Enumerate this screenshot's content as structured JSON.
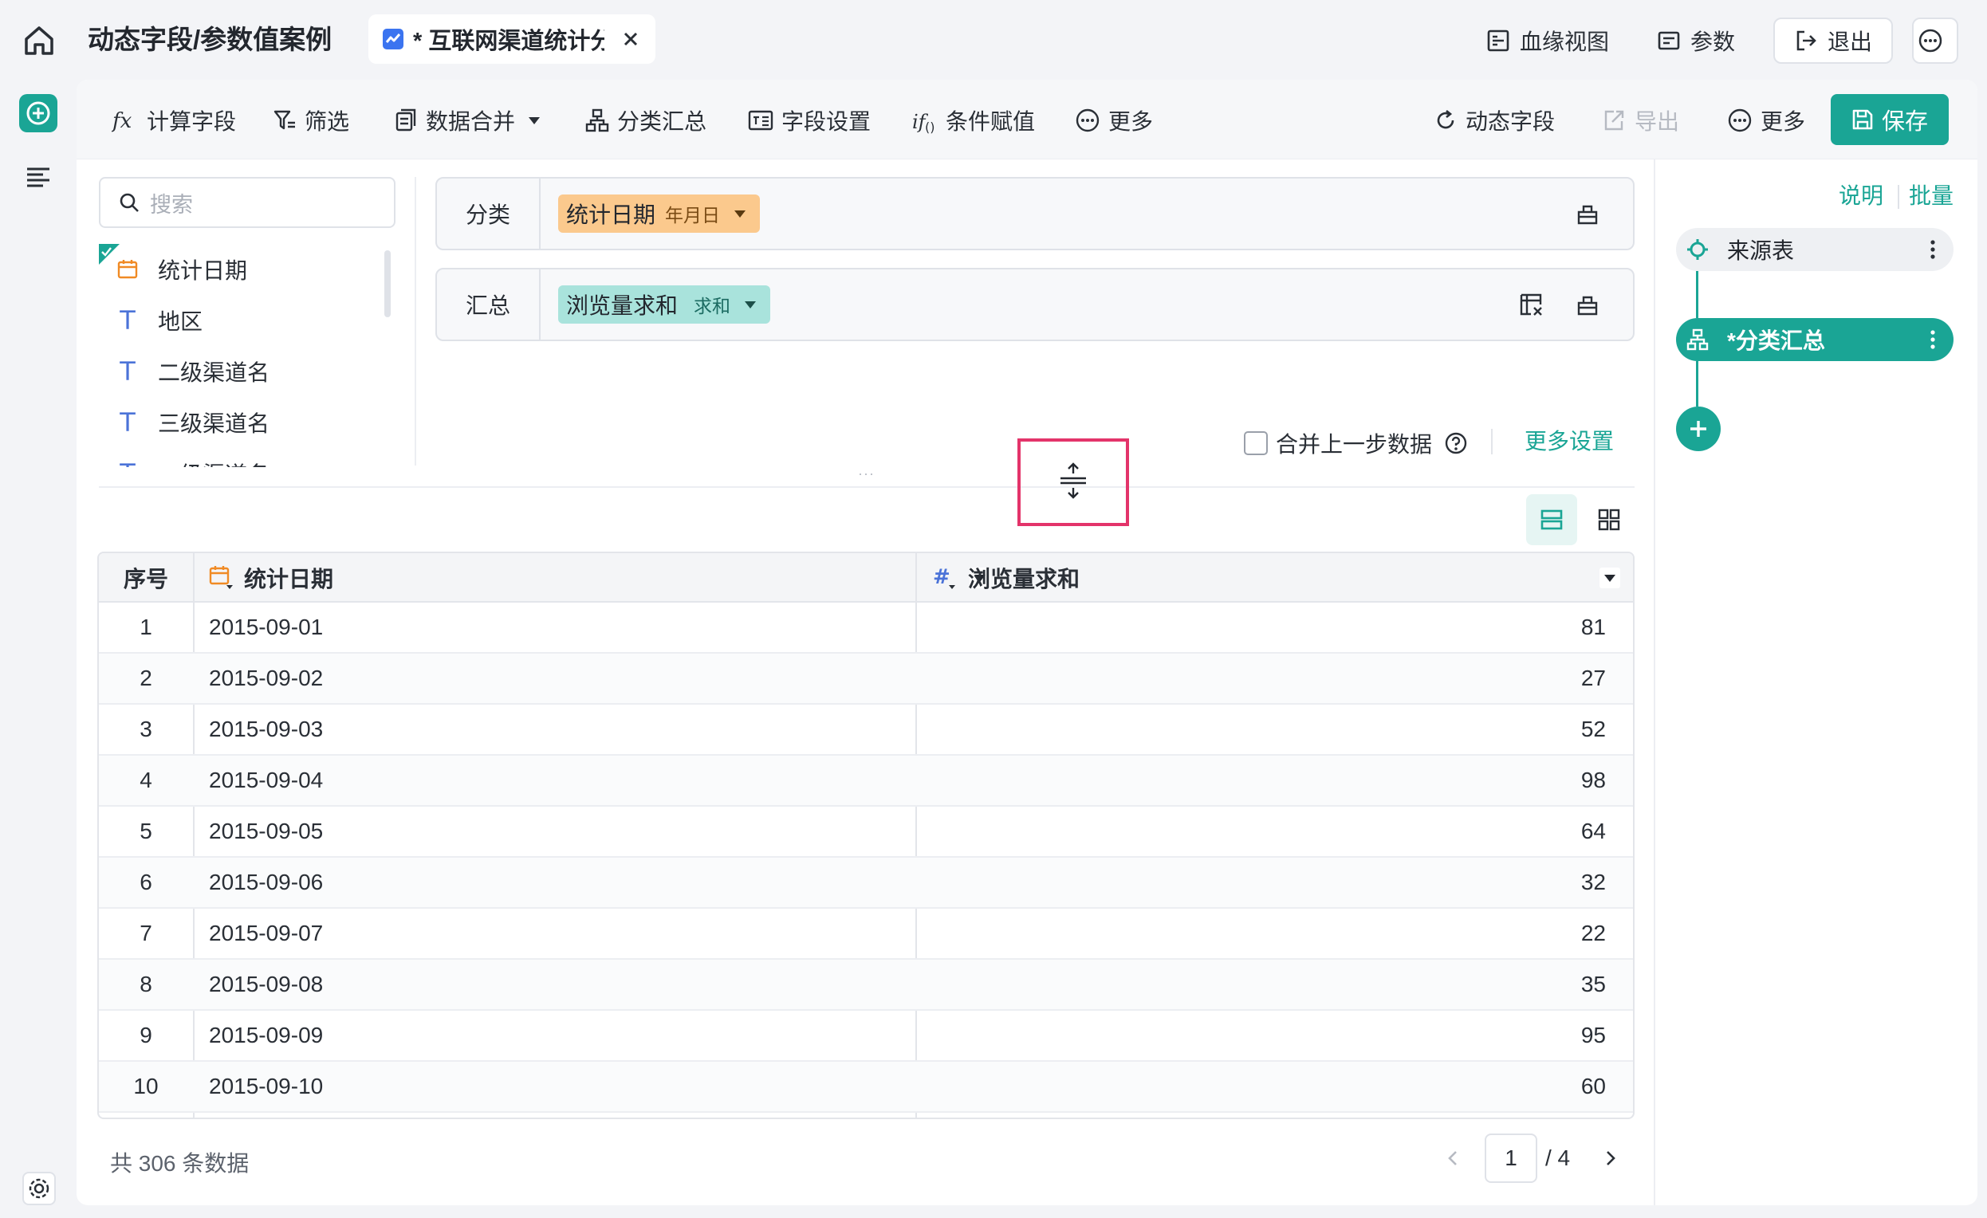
{
  "header": {
    "app_title": "动态字段/参数值案例",
    "tab_label": "* 互联网渠道统计分析",
    "actions": {
      "lineage": "血缘视图",
      "params": "参数",
      "exit": "退出"
    }
  },
  "toolbar": {
    "calc_field": "计算字段",
    "filter": "筛选",
    "merge": "数据合并",
    "group_summary": "分类汇总",
    "field_settings": "字段设置",
    "condition_assign": "条件赋值",
    "more": "更多",
    "dynamic_field": "动态字段",
    "export": "导出",
    "more_right": "更多",
    "save": "保存"
  },
  "field_panel": {
    "search_placeholder": "搜索",
    "fields": [
      {
        "name": "统计日期",
        "type": "date",
        "checked": true
      },
      {
        "name": "地区",
        "type": "text"
      },
      {
        "name": "二级渠道名",
        "type": "text"
      },
      {
        "name": "三级渠道名",
        "type": "text"
      },
      {
        "name": "一级渠道名",
        "type": "text"
      }
    ]
  },
  "config": {
    "group_label": "分类",
    "group_chip": {
      "field": "统计日期",
      "sub": "年月日"
    },
    "summary_label": "汇总",
    "summary_chip": {
      "field": "浏览量求和",
      "sub": "求和"
    },
    "merge_prev": "合并上一步数据",
    "more_settings": "更多设置"
  },
  "table": {
    "headers": {
      "index": "序号",
      "date": "统计日期",
      "value": "浏览量求和"
    },
    "rows": [
      {
        "index": "1",
        "date": "2015-09-01",
        "value": "81"
      },
      {
        "index": "2",
        "date": "2015-09-02",
        "value": "27"
      },
      {
        "index": "3",
        "date": "2015-09-03",
        "value": "52"
      },
      {
        "index": "4",
        "date": "2015-09-04",
        "value": "98"
      },
      {
        "index": "5",
        "date": "2015-09-05",
        "value": "64"
      },
      {
        "index": "6",
        "date": "2015-09-06",
        "value": "32"
      },
      {
        "index": "7",
        "date": "2015-09-07",
        "value": "22"
      },
      {
        "index": "8",
        "date": "2015-09-08",
        "value": "35"
      },
      {
        "index": "9",
        "date": "2015-09-09",
        "value": "95"
      },
      {
        "index": "10",
        "date": "2015-09-10",
        "value": "60"
      }
    ],
    "total_text": "共 306 条数据",
    "page_current": "1",
    "page_total": "/ 4"
  },
  "flow_panel": {
    "explain": "说明",
    "batch": "批量",
    "nodes": [
      {
        "label": "来源表"
      },
      {
        "label": "*分类汇总"
      }
    ]
  },
  "colors": {
    "accent": "#1aa595",
    "date_chip": "#fbc98d",
    "measure_chip": "#a9e3dc",
    "highlight": "#e3346a"
  }
}
